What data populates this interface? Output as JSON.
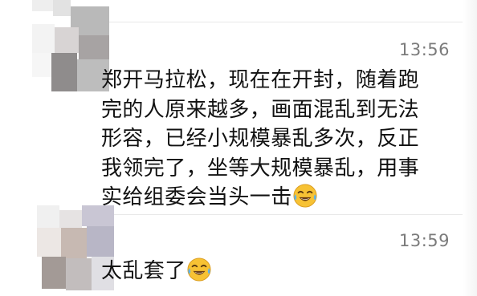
{
  "chat": {
    "messages": [
      {
        "time": "13:56",
        "lines": [
          "郑开马拉松，现在在开封，随着跑",
          "完的人原来越多，画面混乱到无法",
          "形容，已经小规模暴乱多次，反正",
          "我领完了，坐等大规模暴乱，用事",
          "实给组委会当头一击"
        ],
        "emoji": "tears-of-joy-emoji",
        "avatar": "blurred-avatar"
      },
      {
        "time": "13:59",
        "lines": [
          "太乱套了"
        ],
        "emoji": "tears-of-joy-emoji",
        "avatar": "blurred-avatar"
      }
    ]
  },
  "colors": {
    "text": "#111111",
    "time": "#7b7b7b",
    "divider": "#e8e8e8",
    "emoji_face": "#f7c234"
  }
}
